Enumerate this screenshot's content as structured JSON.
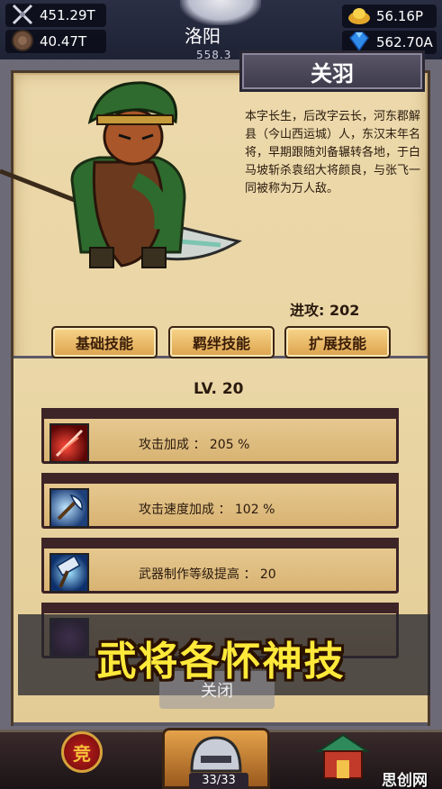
{
  "resources": {
    "attack_power": "451.29T",
    "defense": "40.47T",
    "food": "56.16P",
    "gems": "562.70A"
  },
  "city": {
    "name": "洛阳",
    "sub": "558.3"
  },
  "hero": {
    "name": "关羽",
    "description": "本字长生，后改字云长，河东郡解县（今山西运城）人，东汉末年名将，早期跟随刘备辗转各地，于白马坡斩杀袁绍大将颜良，与张飞一同被称为万人敌。",
    "stat_label": "进攻: 202"
  },
  "tabs": [
    {
      "label": "基础技能"
    },
    {
      "label": "羁绊技能"
    },
    {
      "label": "扩展技能"
    }
  ],
  "level": "LV. 20",
  "skills": [
    {
      "text": "攻击加成 ： 205 %",
      "icon": "red-slash-icon"
    },
    {
      "text": "攻击速度加成 ： 102 %",
      "icon": "blue-axe-icon"
    },
    {
      "text": "武器制作等级提高 ： 20",
      "icon": "blue-hammer-icon"
    },
    {
      "text": "",
      "icon": "purple-swirl-icon"
    }
  ],
  "banner": "武将各怀神技",
  "close_label": "关闭",
  "bottom": {
    "arena_label": "竞",
    "counter": "33/33",
    "watermark": "思创网"
  },
  "colors": {
    "parchment": "#e8d3a2",
    "tab_gold": "#dca24d",
    "banner_yellow": "#ffe93a",
    "frame_dark": "#4a3a2c"
  }
}
